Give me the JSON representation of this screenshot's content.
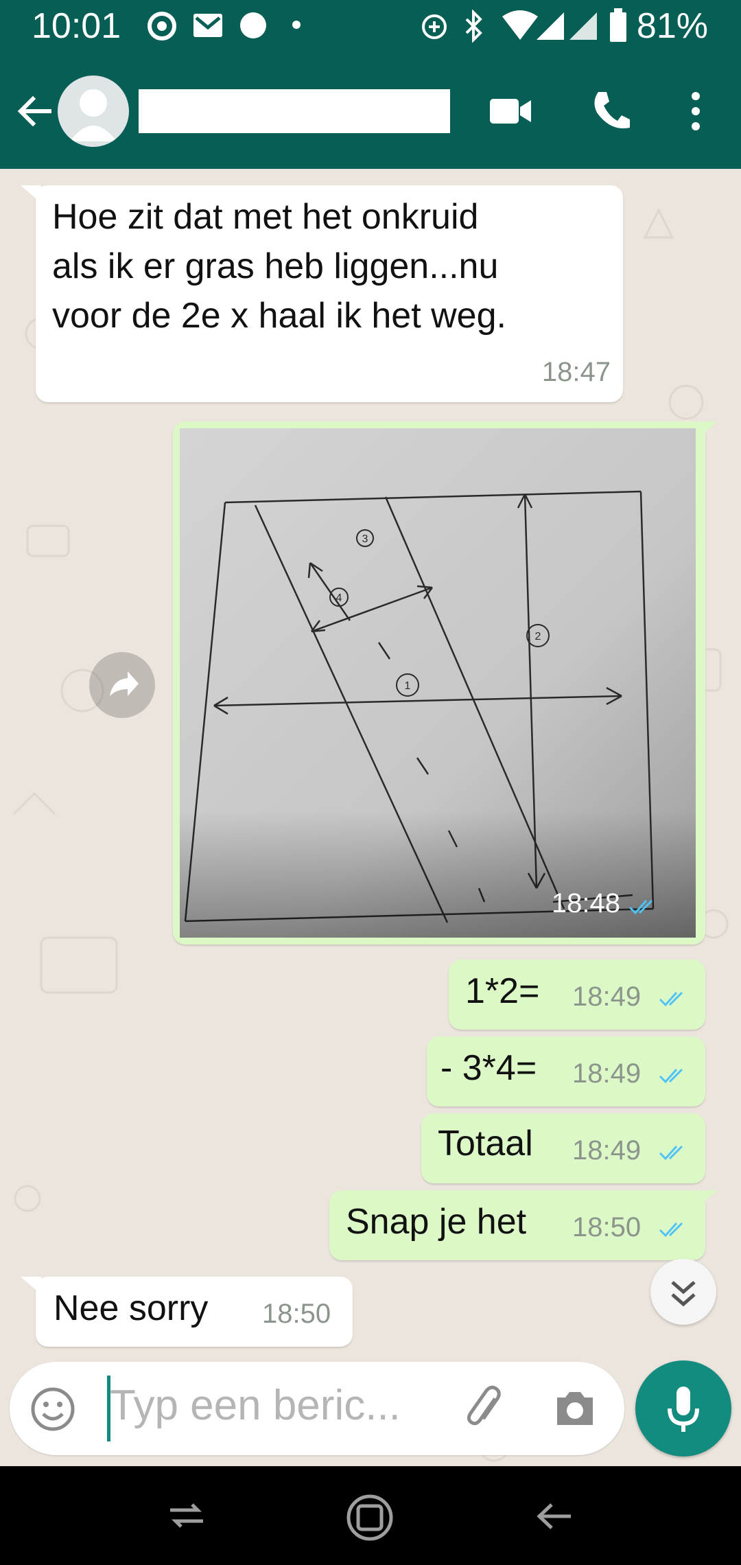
{
  "status_bar": {
    "time": "10:01",
    "battery_percent": "81%"
  },
  "header": {
    "contact_name": ""
  },
  "messages": [
    {
      "direction": "incoming",
      "text": "Hoe zit dat met het onkruid als ik er gras heb liggen...nu voor de 2e x haal ik het weg.",
      "lines": [
        "Hoe zit dat met het onkruid",
        "als ik er gras heb liggen...nu",
        "voor de 2e x haal ik het weg."
      ],
      "time": "18:47"
    },
    {
      "direction": "outgoing",
      "type": "image",
      "time": "18:48",
      "image_labels": [
        "1",
        "2",
        "3",
        "4"
      ]
    },
    {
      "direction": "outgoing",
      "text": "1*2=",
      "time": "18:49"
    },
    {
      "direction": "outgoing",
      "text": "- 3*4=",
      "time": "18:49"
    },
    {
      "direction": "outgoing",
      "text": "Totaal",
      "time": "18:49"
    },
    {
      "direction": "outgoing",
      "text": "Snap je het",
      "time": "18:50"
    },
    {
      "direction": "incoming",
      "text": "Nee sorry",
      "time": "18:50"
    }
  ],
  "input": {
    "placeholder": "Typ een beric..."
  },
  "icons": [
    "back-arrow-icon",
    "video-call-icon",
    "phone-call-icon",
    "more-options-icon",
    "forward-icon",
    "scroll-down-icon",
    "emoji-icon",
    "attach-icon",
    "camera-icon",
    "mic-icon",
    "nav-recents-icon",
    "nav-home-icon",
    "nav-back-icon"
  ],
  "colors": {
    "header": "#075e54",
    "outgoing_bubble": "#dcf8c6",
    "incoming_bubble": "#ffffff",
    "accent": "#128c7e",
    "read_check": "#4fc3f7"
  }
}
